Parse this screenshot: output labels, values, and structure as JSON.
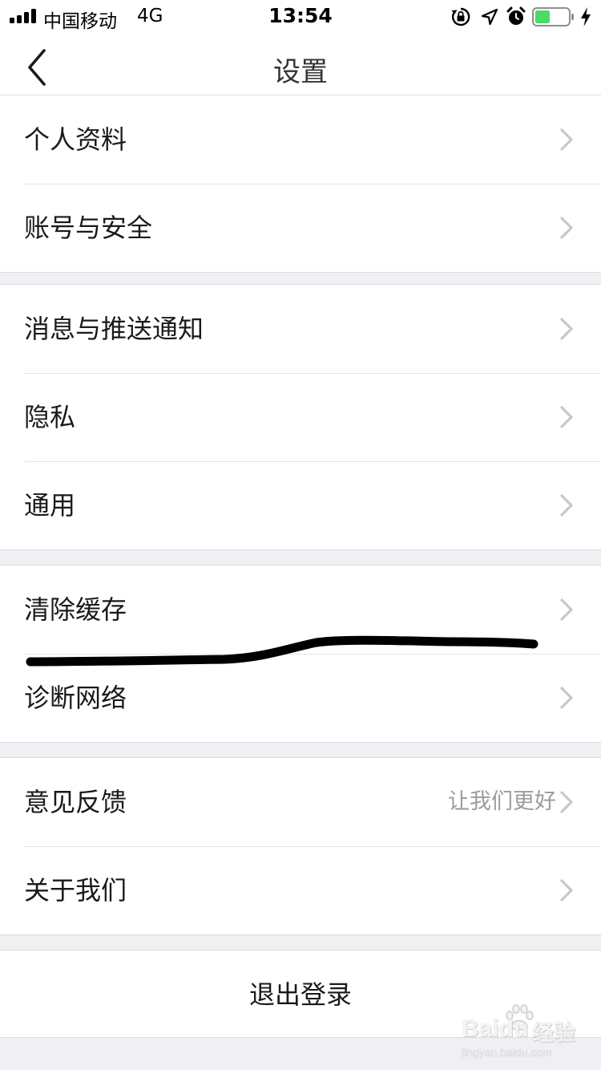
{
  "status_bar": {
    "carrier": "中国移动",
    "network": "4G",
    "time": "13:54",
    "signal_bars": 4,
    "battery_level": 0.45,
    "battery_color": "#4cd964",
    "icons": [
      "orientation-lock-icon",
      "location-arrow-icon",
      "alarm-icon",
      "battery-icon",
      "charging-bolt-icon"
    ]
  },
  "nav": {
    "title": "设置",
    "back_icon": "chevron-left-icon"
  },
  "groups": [
    {
      "items": [
        {
          "label": "个人资料"
        },
        {
          "label": "账号与安全"
        }
      ]
    },
    {
      "items": [
        {
          "label": "消息与推送通知"
        },
        {
          "label": "隐私"
        },
        {
          "label": "通用"
        }
      ]
    },
    {
      "items": [
        {
          "label": "清除缓存"
        },
        {
          "label": "诊断网络"
        }
      ]
    },
    {
      "items": [
        {
          "label": "意见反馈",
          "detail": "让我们更好"
        },
        {
          "label": "关于我们"
        }
      ]
    }
  ],
  "logout": {
    "label": "退出登录"
  },
  "watermark": {
    "brand": "Baidu",
    "brand_cn": "经验",
    "url": "jingyan.baidu.com"
  },
  "colors": {
    "page_background": "#efeff4",
    "cell_background": "#ffffff",
    "separator": "#e5e5e5",
    "chevron": "#c7c7cc",
    "detail_text": "#9b9b9b",
    "annotation_stroke": "#000000"
  }
}
